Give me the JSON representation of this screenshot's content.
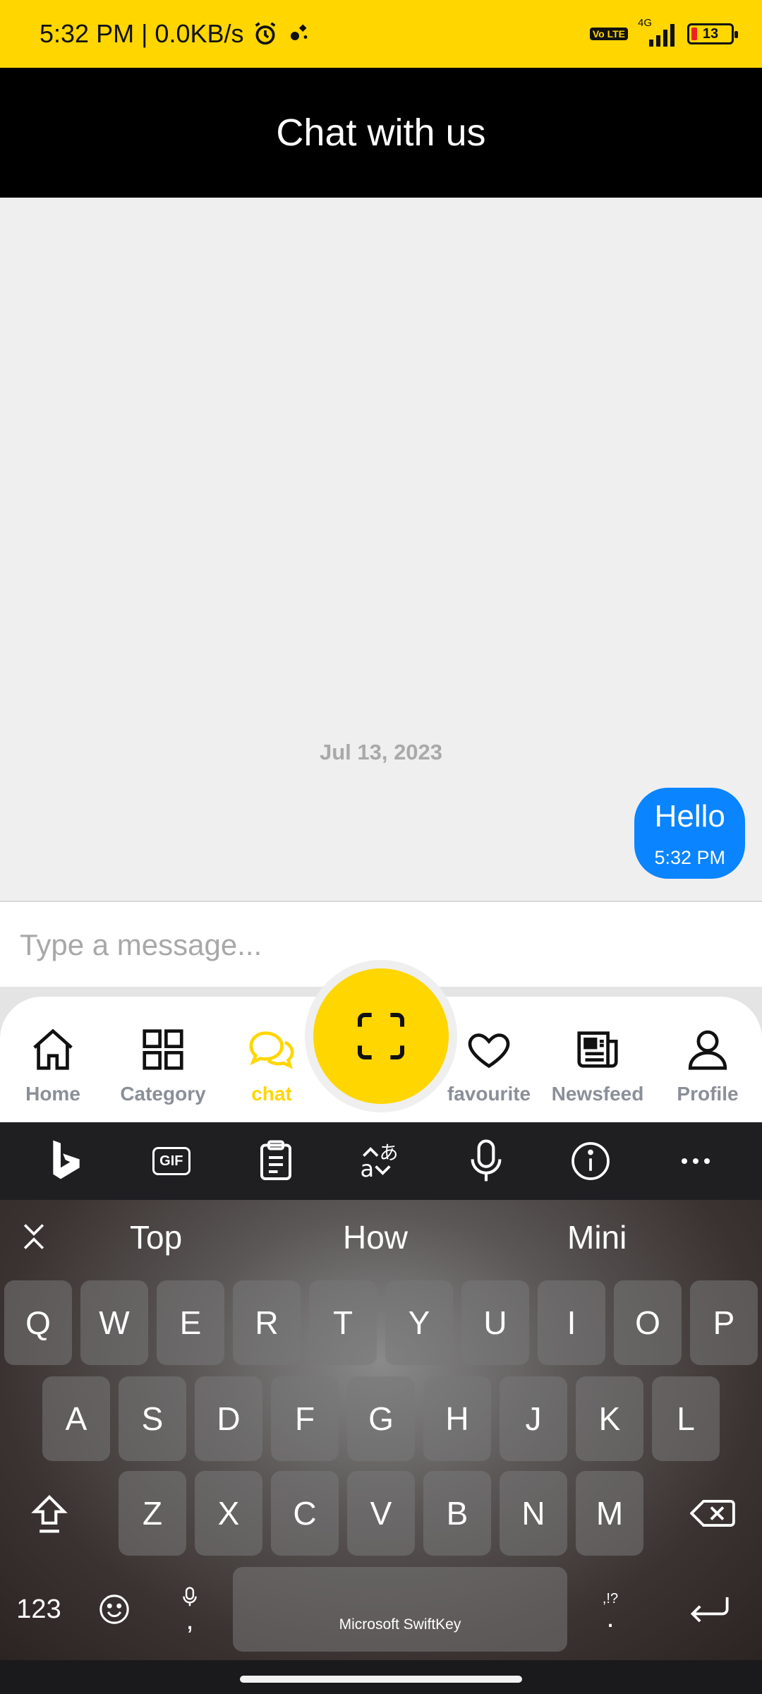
{
  "status_bar": {
    "time_speed": "5:32 PM | 0.0KB/s",
    "volte": "Vo LTE",
    "network": "4G",
    "battery": "13"
  },
  "header": {
    "title": "Chat with us"
  },
  "chat": {
    "date_separator": "Jul 13, 2023",
    "messages": [
      {
        "text": "Hello",
        "time": "5:32 PM",
        "sender": "me"
      }
    ]
  },
  "composer": {
    "placeholder": "Type a message..."
  },
  "bottom_nav": {
    "items": [
      {
        "label": "Home",
        "icon": "home-icon"
      },
      {
        "label": "Category",
        "icon": "grid-icon"
      },
      {
        "label": "chat",
        "icon": "chat-bubble-icon",
        "active": true
      },
      {
        "label": "favourite",
        "icon": "heart-icon"
      },
      {
        "label": "Newsfeed",
        "icon": "newspaper-icon"
      },
      {
        "label": "Profile",
        "icon": "user-icon"
      }
    ],
    "fab_icon": "scan-icon",
    "accent_color": "#FFD600"
  },
  "keyboard": {
    "toolbar_icons": [
      "bing-icon",
      "gif-icon",
      "clipboard-icon",
      "translate-icon",
      "mic-icon",
      "info-icon",
      "more-icon"
    ],
    "gif_label": "GIF",
    "suggestions": [
      "Top",
      "How",
      "Mini"
    ],
    "rows": [
      [
        "Q",
        "W",
        "E",
        "R",
        "T",
        "Y",
        "U",
        "I",
        "O",
        "P"
      ],
      [
        "A",
        "S",
        "D",
        "F",
        "G",
        "H",
        "J",
        "K",
        "L"
      ],
      [
        "Z",
        "X",
        "C",
        "V",
        "B",
        "N",
        "M"
      ]
    ],
    "numbers_key": "123",
    "comma_key": ",",
    "period_key": ".",
    "punct_hint": ",!?",
    "space_label": "Microsoft SwiftKey"
  }
}
